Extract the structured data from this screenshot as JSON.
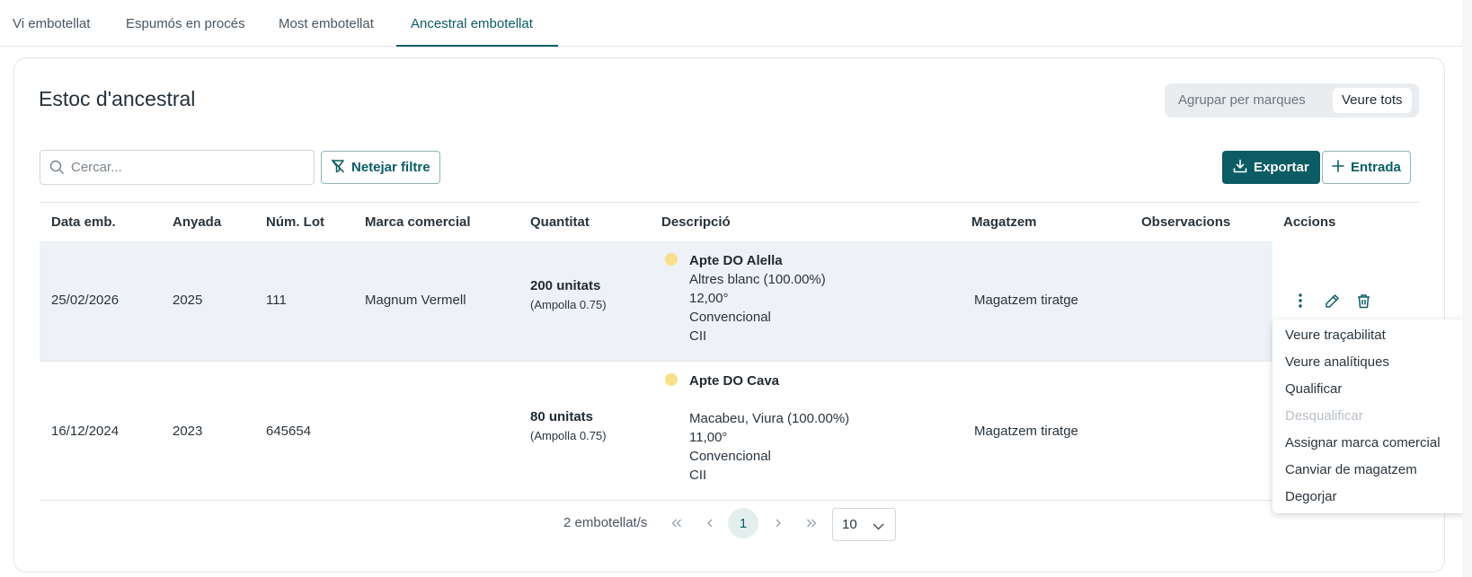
{
  "tabs": [
    {
      "label": "Vi embotellat"
    },
    {
      "label": "Espumós en procés"
    },
    {
      "label": "Most embotellat"
    },
    {
      "label": "Ancestral embotellat"
    }
  ],
  "page_title": "Estoc d'ancestral",
  "view_toggle": {
    "group_label": "Agrupar per marques",
    "all_label": "Veure tots",
    "selected": "Veure tots"
  },
  "search": {
    "placeholder": "Cercar...",
    "value": ""
  },
  "toolbar": {
    "clear_filter_label": "Netejar filtre",
    "export_label": "Exportar",
    "entry_label": "Entrada"
  },
  "table": {
    "headers": [
      "Data emb.",
      "Anyada",
      "Núm. Lot",
      "Marca comercial",
      "Quantitat",
      "Descripció",
      "Magatzem",
      "Observacions",
      "Accions"
    ],
    "rows": [
      {
        "date": "25/02/2026",
        "vintage": "2025",
        "lot": "111",
        "brand": "Magnum Vermell",
        "qty": "200 unitats",
        "qty_sub": "(Ampolla 0.75)",
        "desc_title": "Apte DO Alella",
        "desc_lines": [
          "Altres blanc (100.00%)",
          "12,00°",
          "Convencional",
          "CII"
        ],
        "store": "Magatzem tiratge",
        "notes": "",
        "status_color": "#f7e08a"
      },
      {
        "date": "16/12/2024",
        "vintage": "2023",
        "lot": "645654",
        "brand": "",
        "qty": "80 unitats",
        "qty_sub": "(Ampolla 0.75)",
        "desc_title": "Apte DO Cava",
        "desc_lines": [
          "Macabeu, Viura (100.00%)",
          "11,00°",
          "Convencional",
          "CII"
        ],
        "store": "Magatzem tiratge",
        "notes": "",
        "status_color": "#f7e08a"
      }
    ]
  },
  "context_menu": {
    "items": [
      {
        "label": "Veure traçabilitat"
      },
      {
        "label": "Veure analítiques"
      },
      {
        "label": "Qualificar"
      },
      {
        "label": "Desqualificar"
      },
      {
        "label": "Assignar marca comercial"
      },
      {
        "label": "Canviar de magatzem"
      },
      {
        "label": "Degorjar"
      }
    ]
  },
  "pagination": {
    "count_text": "2 embotellat/s",
    "current_page": "1",
    "page_size": "10"
  },
  "colors": {
    "accent": "#0b5c64",
    "row_highlight": "#eef2f6",
    "status_dot": "#f7e08a"
  }
}
